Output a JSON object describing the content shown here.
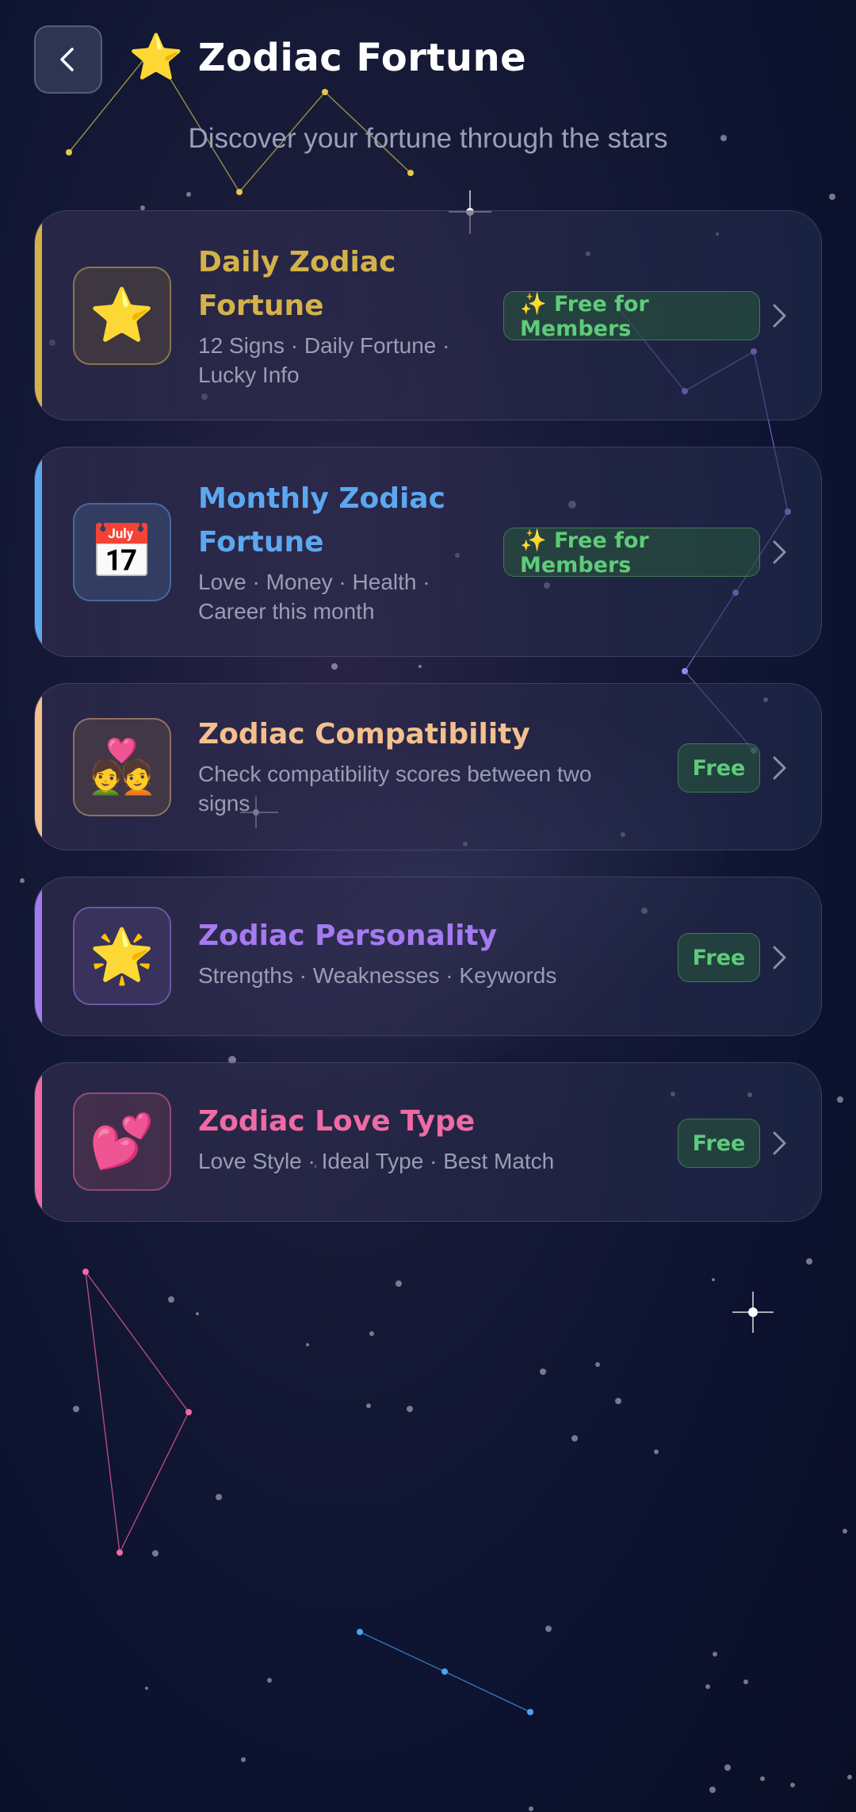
{
  "header": {
    "title": "Zodiac Fortune",
    "title_icon": "⭐",
    "subtitle": "Discover your fortune through the stars"
  },
  "cards": [
    {
      "title_line1": "Daily Zodiac",
      "title_line2": "Fortune",
      "desc_line1": "12 Signs · Daily Fortune ·",
      "desc_line2": "Lucky Info",
      "icon": "⭐",
      "icon_name": "star-icon",
      "badge": "✨ Free for Members",
      "color": "#d4b24a"
    },
    {
      "title_line1": "Monthly Zodiac",
      "title_line2": "Fortune",
      "desc_line1": "Love · Money · Health ·",
      "desc_line2": "Career this month",
      "icon": "📅",
      "icon_name": "calendar-icon",
      "badge": "✨ Free for Members",
      "color": "#5ba8f0"
    },
    {
      "title": "Zodiac Compatibility",
      "desc_line1": "Check compatibility scores between two",
      "desc_line2": "signs",
      "icon": "💑",
      "icon_name": "couple-icon",
      "badge": "Free",
      "color": "#f3c08e"
    },
    {
      "title": "Zodiac Personality",
      "desc": "Strengths · Weaknesses · Keywords",
      "icon": "🌟",
      "icon_name": "glowing-star-icon",
      "badge": "Free",
      "color": "#a57af0"
    },
    {
      "title": "Zodiac Love Type",
      "desc": "Love Style · Ideal Type · Best Match",
      "icon": "💕",
      "icon_name": "two-hearts-icon",
      "badge": "Free",
      "color": "#f06aa4"
    }
  ]
}
